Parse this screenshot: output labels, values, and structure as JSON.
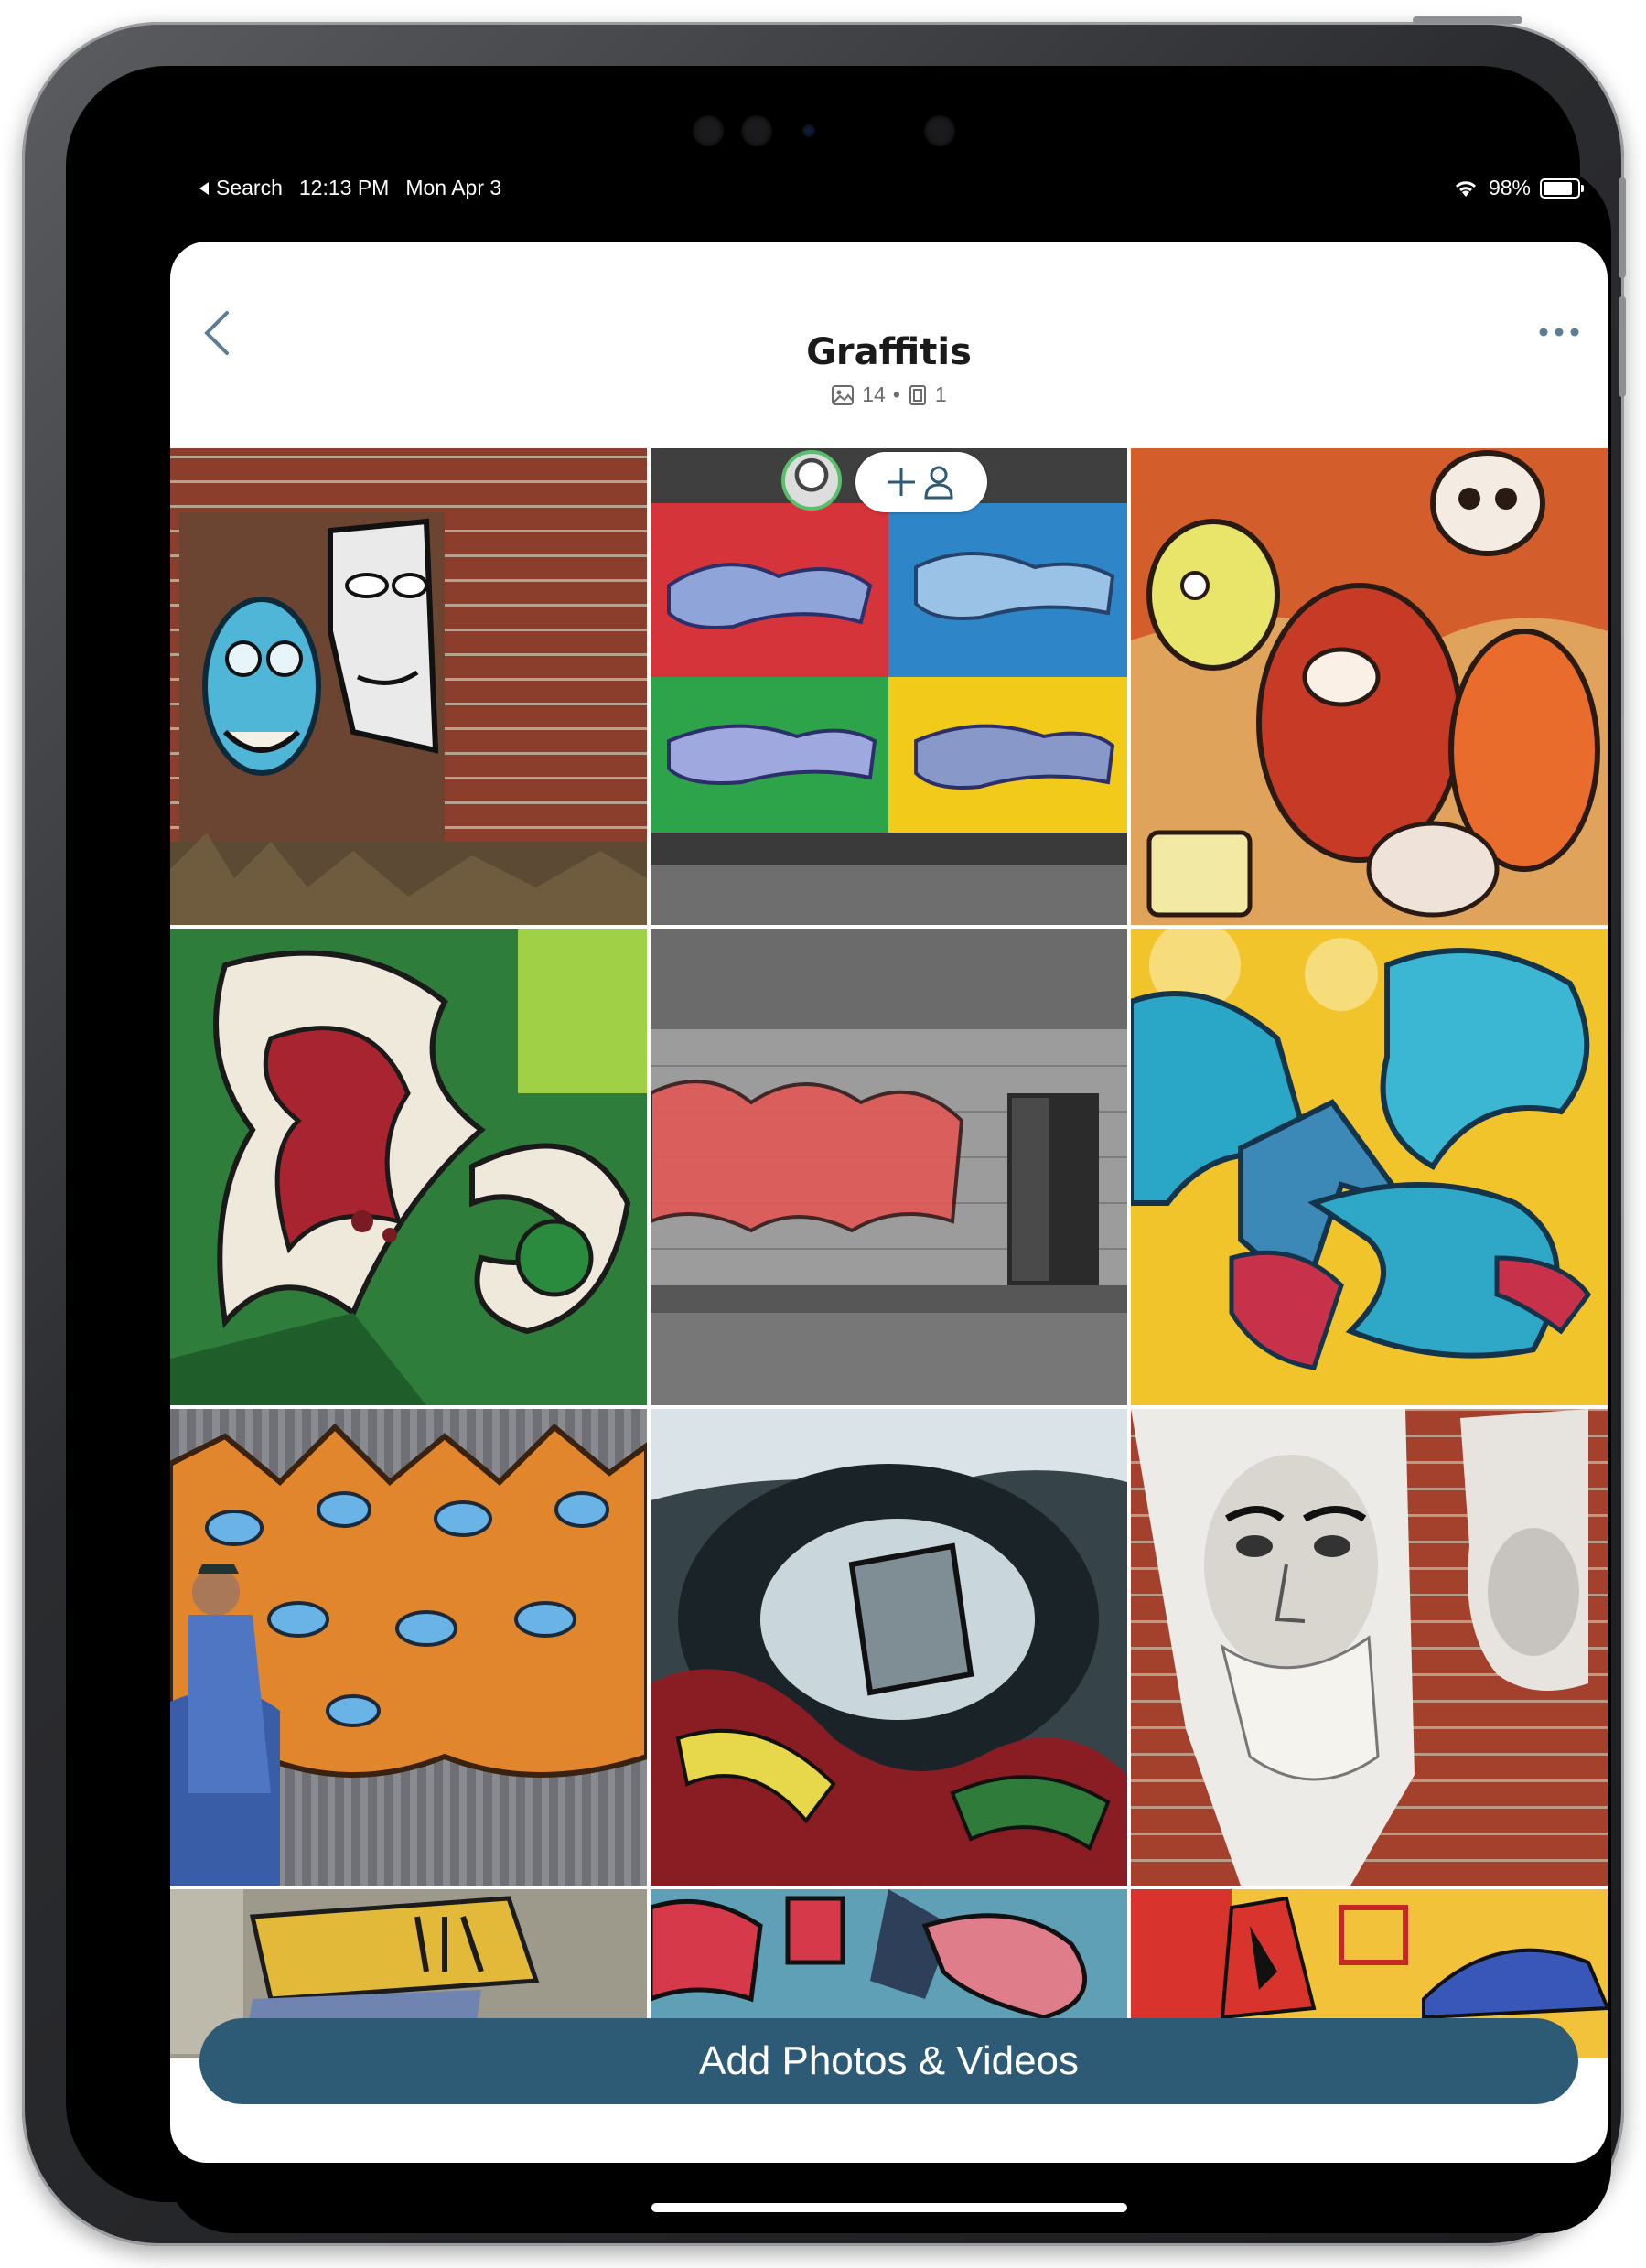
{
  "status_bar": {
    "back_app": "Search",
    "time": "12:13 PM",
    "date": "Mon Apr 3",
    "battery": "98%",
    "battery_level": 0.98,
    "wifi_icon": "wifi-icon"
  },
  "album": {
    "title": "Graffitis",
    "photo_count": "14",
    "separator": "•",
    "album_count": "1"
  },
  "icons": {
    "back": "chevron-left-icon",
    "more": "more-horizontal-icon",
    "photo": "photo-icon",
    "album": "album-icon",
    "add_person": "add-person-icon"
  },
  "colors": {
    "accent": "#2d5a75",
    "back_icon": "#5b7d95",
    "avatar_ring": "#58c06a"
  },
  "photos": [
    {
      "name": "photo-1"
    },
    {
      "name": "photo-2"
    },
    {
      "name": "photo-3"
    },
    {
      "name": "photo-4"
    },
    {
      "name": "photo-5"
    },
    {
      "name": "photo-6"
    },
    {
      "name": "photo-7"
    },
    {
      "name": "photo-8"
    },
    {
      "name": "photo-9"
    },
    {
      "name": "photo-10"
    },
    {
      "name": "photo-11"
    },
    {
      "name": "photo-12"
    }
  ],
  "actions": {
    "add_label": "Add Photos & Videos"
  }
}
